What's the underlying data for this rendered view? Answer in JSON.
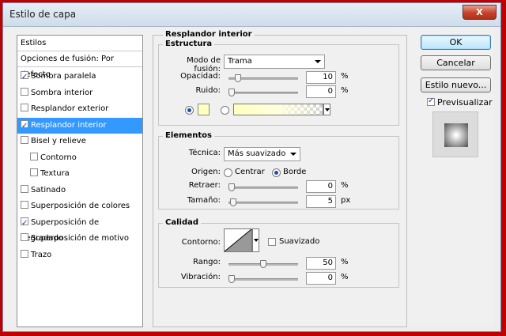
{
  "window": {
    "title": "Estilo de capa",
    "close_glyph": "X"
  },
  "styles_list": {
    "header": "Estilos",
    "blend_options": "Opciones de fusión: Por defecto",
    "items": [
      {
        "label": "Sombra paralela",
        "checked": true,
        "indent": false,
        "selected": false
      },
      {
        "label": "Sombra interior",
        "checked": false,
        "indent": false,
        "selected": false
      },
      {
        "label": "Resplandor exterior",
        "checked": false,
        "indent": false,
        "selected": false
      },
      {
        "label": "Resplandor interior",
        "checked": true,
        "indent": false,
        "selected": true
      },
      {
        "label": "Bisel y relieve",
        "checked": false,
        "indent": false,
        "selected": false
      },
      {
        "label": "Contorno",
        "checked": false,
        "indent": true,
        "selected": false
      },
      {
        "label": "Textura",
        "checked": false,
        "indent": true,
        "selected": false
      },
      {
        "label": "Satinado",
        "checked": false,
        "indent": false,
        "selected": false
      },
      {
        "label": "Superposición de colores",
        "checked": false,
        "indent": false,
        "selected": false
      },
      {
        "label": "Superposición de degradado",
        "checked": true,
        "indent": false,
        "selected": false
      },
      {
        "label": "Superposición de motivo",
        "checked": false,
        "indent": false,
        "selected": false
      },
      {
        "label": "Trazo",
        "checked": false,
        "indent": false,
        "selected": false
      }
    ]
  },
  "panel": {
    "title": "Resplandor interior",
    "estructura": {
      "title": "Estructura",
      "blend_mode_label": "Modo de fusión:",
      "blend_mode_value": "Trama",
      "opacity_label": "Opacidad:",
      "opacity_value": "10",
      "opacity_fraction": 0.1,
      "noise_label": "Ruido:",
      "noise_value": "0",
      "noise_fraction": 0.0,
      "percent": "%",
      "solid_color": "#ffffc0"
    },
    "elementos": {
      "title": "Elementos",
      "technique_label": "Técnica:",
      "technique_value": "Más suavizado",
      "origin_label": "Origen:",
      "origin_center": "Centrar",
      "origin_edge": "Borde",
      "choke_label": "Retraer:",
      "choke_value": "0",
      "choke_fraction": 0.0,
      "size_label": "Tamaño:",
      "size_value": "5",
      "size_fraction": 0.02,
      "percent": "%",
      "px": "px"
    },
    "calidad": {
      "title": "Calidad",
      "contour_label": "Contorno:",
      "antialias_label": "Suavizado",
      "range_label": "Rango:",
      "range_value": "50",
      "range_fraction": 0.5,
      "jitter_label": "Vibración:",
      "jitter_value": "0",
      "jitter_fraction": 0.0,
      "percent": "%"
    }
  },
  "buttons": {
    "ok": "OK",
    "cancel": "Cancelar",
    "new_style": "Estilo nuevo...",
    "preview_label": "Previsualizar"
  }
}
